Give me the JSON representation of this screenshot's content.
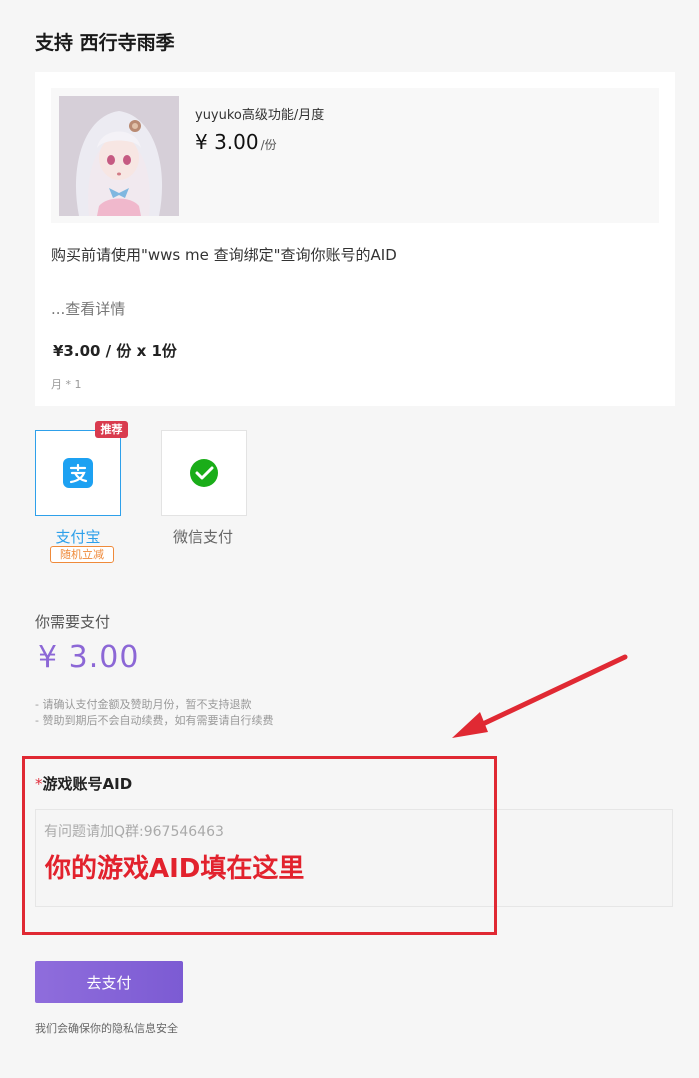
{
  "page": {
    "title": "支持 西行寺雨季"
  },
  "order": {
    "product_name": "yuyuko高级功能/月度",
    "price": "¥ 3.00",
    "price_unit": "/份",
    "description": "购买前请使用\"wws me 查询绑定\"查询你账号的AID",
    "more_label": "...查看详情",
    "quantity_line": "¥3.00 / 份  x  1份",
    "period": "月 * 1"
  },
  "payment": {
    "methods": [
      {
        "label": "支付宝",
        "icon": "alipay-icon",
        "color": "#1da1f2",
        "selected": true,
        "badge": "推荐",
        "promo": "随机立减"
      },
      {
        "label": "微信支付",
        "icon": "wechat-pay-icon",
        "color": "#1aad19",
        "selected": false
      }
    ]
  },
  "summary": {
    "need_pay_label": "你需要支付",
    "amount": "¥ 3.00",
    "notes": [
      "- 请确认支付金额及赞助月份，暂不支持退款",
      "- 赞助到期后不会自动续费，如有需要请自行续费"
    ]
  },
  "aid_field": {
    "required_mark": "*",
    "label": "游戏账号AID",
    "placeholder": "有问题请加Q群:967546463",
    "annotation": "你的游戏AID填在这里"
  },
  "actions": {
    "pay_button": "去支付",
    "privacy_note": "我们会确保你的隐私信息安全"
  },
  "colors": {
    "accent": "#8c67d6",
    "annotation_red": "#e02933"
  }
}
